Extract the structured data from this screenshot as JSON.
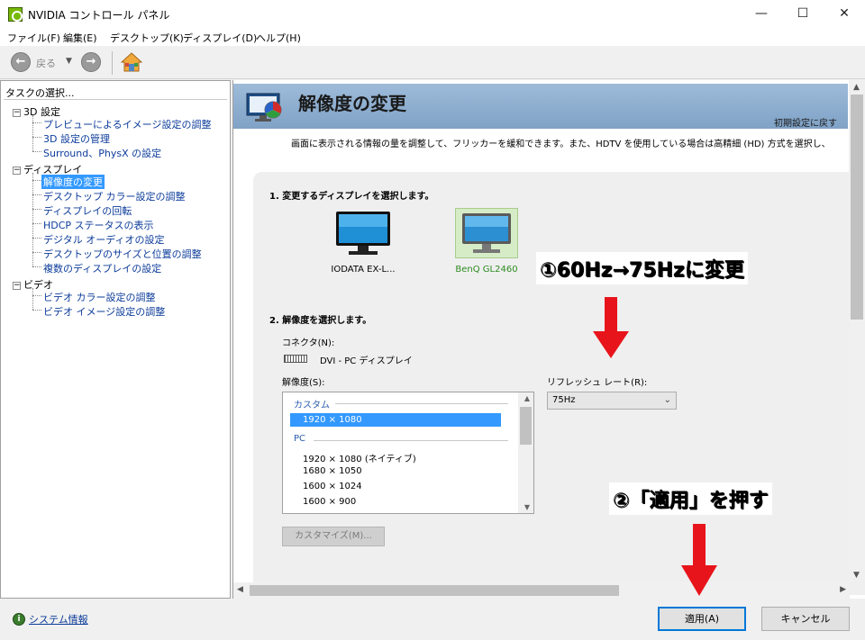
{
  "window": {
    "title": "NVIDIA コントロール パネル",
    "minimize": "—",
    "maximize": "☐",
    "close": "✕"
  },
  "menu": [
    "ファイル(F)",
    "編集(E)",
    "デスクトップ(K)",
    "ディスプレイ(D)",
    "ヘルプ(H)"
  ],
  "toolbar": {
    "back_label": "戻る"
  },
  "left_pane": {
    "title": "タスクの選択...",
    "categories": [
      {
        "label": "3D 設定",
        "items": [
          "プレビューによるイメージ設定の調整",
          "3D 設定の管理",
          "Surround、PhysX の設定"
        ]
      },
      {
        "label": "ディスプレイ",
        "items": [
          "解像度の変更",
          "デスクトップ カラー設定の調整",
          "ディスプレイの回転",
          "HDCP ステータスの表示",
          "デジタル オーディオの設定",
          "デスクトップのサイズと位置の調整",
          "複数のディスプレイの設定"
        ]
      },
      {
        "label": "ビデオ",
        "items": [
          "ビデオ カラー設定の調整",
          "ビデオ イメージ設定の調整"
        ]
      }
    ],
    "selected": "解像度の変更"
  },
  "page": {
    "title": "解像度の変更",
    "restore_defaults": "初期設定に戻す",
    "description": "画面に表示される情報の量を調整して、フリッカーを緩和できます。また、HDTV を使用している場合は高精細 (HD) 方式を選択し、",
    "section1_title": "1. 変更するディスプレイを選択します。",
    "displays": [
      {
        "name": "IODATA EX-L...",
        "selected": false
      },
      {
        "name": "BenQ GL2460",
        "selected": true
      }
    ],
    "section2_title": "2. 解像度を選択します。",
    "connector_label": "コネクタ(N):",
    "connector_value": "DVI - PC ディスプレイ",
    "resolution_label": "解像度(S):",
    "resolution_groups": [
      {
        "group": "カスタム",
        "rows": [
          "1920 × 1080"
        ]
      },
      {
        "group": "PC",
        "rows": [
          "1920 × 1080 (ネイティブ)",
          "1680 × 1050",
          "1600 × 1024",
          "1600 × 900"
        ]
      }
    ],
    "selected_resolution": "1920 × 1080",
    "refresh_label": "リフレッシュ レート(R):",
    "refresh_value": "75Hz",
    "customize_button": "カスタマイズ(M)..."
  },
  "bottom": {
    "system_info": "システム情報",
    "apply": "適用(A)",
    "cancel": "キャンセル"
  },
  "annotations": {
    "step1": "①60Hz→75Hzに変更",
    "step2": "②「適用」を押す",
    "arrow_color": "#e8141b"
  }
}
